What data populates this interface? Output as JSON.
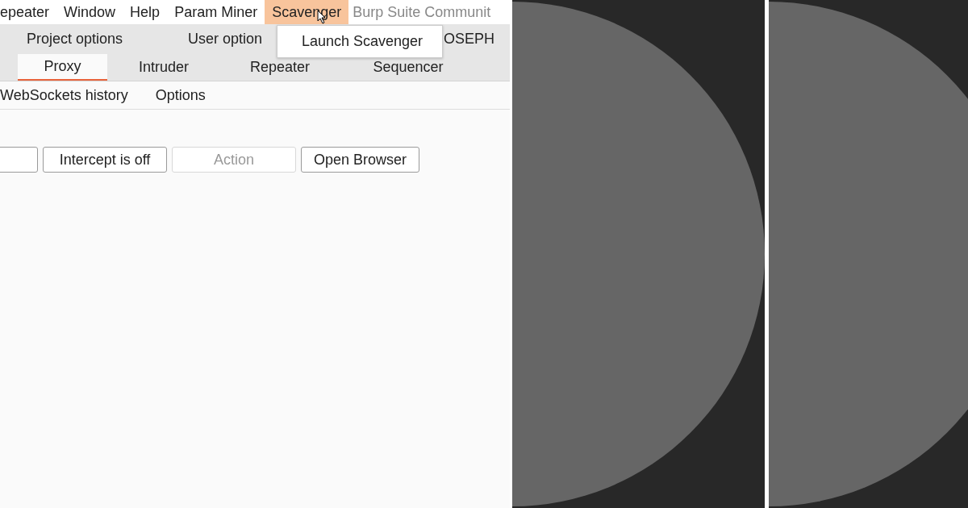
{
  "menu_bar": {
    "items": [
      {
        "label": "epeater",
        "selected": false
      },
      {
        "label": "Window",
        "selected": false
      },
      {
        "label": "Help",
        "selected": false
      },
      {
        "label": "Param Miner",
        "selected": false
      },
      {
        "label": "Scavenger",
        "selected": true
      }
    ],
    "window_title": "Burp Suite Communit"
  },
  "dropdown": {
    "items": [
      "Launch Scavenger"
    ]
  },
  "main_tabs": [
    {
      "label": "Project options"
    },
    {
      "label": "User option"
    },
    {
      "label": "OSEPH"
    }
  ],
  "tool_tabs": [
    {
      "label": "Proxy",
      "selected": true
    },
    {
      "label": "Intruder",
      "selected": false
    },
    {
      "label": "Repeater",
      "selected": false
    },
    {
      "label": "Sequencer",
      "selected": false
    }
  ],
  "sub_tabs": [
    {
      "label": "WebSockets history"
    },
    {
      "label": "Options"
    }
  ],
  "toolbar": [
    {
      "disabled": false
    },
    {
      "label": "Intercept is off",
      "disabled": false
    },
    {
      "label": "Action",
      "disabled": true
    },
    {
      "label": "Open Browser",
      "disabled": false
    }
  ]
}
